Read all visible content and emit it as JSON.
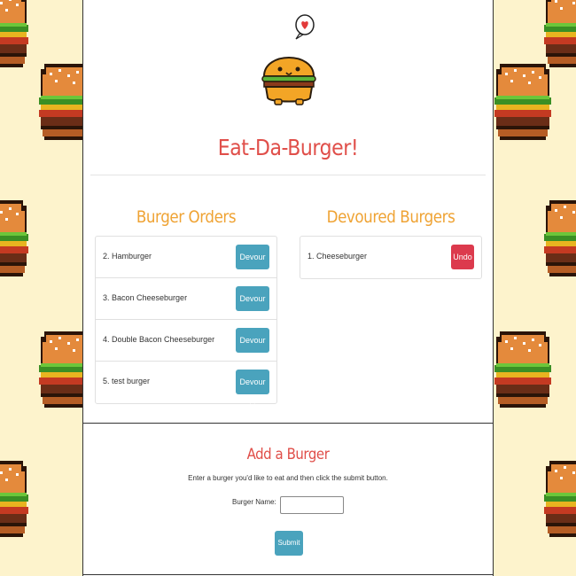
{
  "header": {
    "title": "Eat-Da-Burger!"
  },
  "orders": {
    "heading": "Burger Orders",
    "button_label": "Devour it!",
    "items": [
      {
        "label": "2. Hamburger"
      },
      {
        "label": "3. Bacon Cheeseburger"
      },
      {
        "label": "4. Double Bacon Cheeseburger"
      },
      {
        "label": "5. test burger"
      }
    ]
  },
  "devoured": {
    "heading": "Devoured Burgers",
    "button_label": "Undo",
    "items": [
      {
        "label": "1. Cheeseburger"
      }
    ]
  },
  "add_form": {
    "heading": "Add a Burger",
    "instructions": "Enter a burger you'd like to eat and then click the submit button.",
    "name_label": "Burger Name:",
    "name_value": "",
    "submit_label": "Submit"
  },
  "colors": {
    "title": "#e04f4a",
    "section_heading": "#efa334",
    "devour_button": "#4aa3bd",
    "undo_button": "#dc3a4d",
    "background": "#fdf3cc"
  }
}
